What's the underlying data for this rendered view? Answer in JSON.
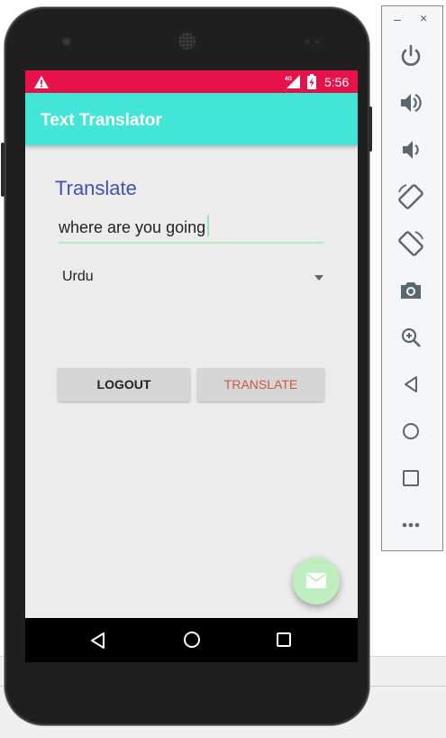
{
  "status_bar": {
    "time": "5:56",
    "network": "4G"
  },
  "app_bar": {
    "title": "Text Translator"
  },
  "form": {
    "label": "Translate",
    "input_value": "where are you going",
    "language_selected": "Urdu"
  },
  "buttons": {
    "logout": "LOGOUT",
    "translate": "TRANSLATE"
  },
  "toolbar": {
    "minimize": "–",
    "close": "×"
  },
  "colors": {
    "status_bar": "#e8124b",
    "app_bar": "#43e6d6",
    "label": "#3f51b5",
    "translate_button_text": "#d1563b",
    "fab": "#bfeec0"
  }
}
